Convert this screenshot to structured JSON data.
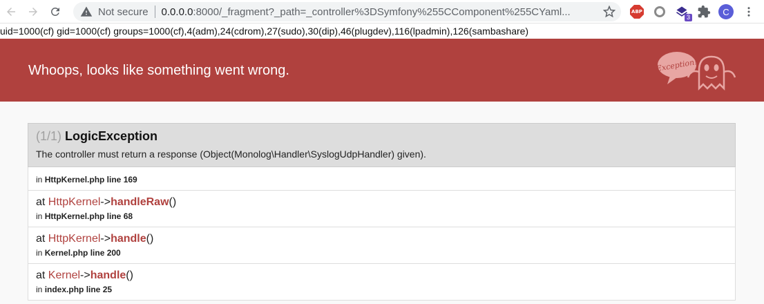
{
  "browser": {
    "not_secure": "Not secure",
    "url_host": "0.0.0.0",
    "url_rest": ":8000/_fragment?_path=_controller%3DSymfony%255CComponent%255CYaml...",
    "ext_abp": "ABP",
    "ext_badge": "3",
    "avatar_letter": "C",
    "icons": [
      "back-icon",
      "forward-icon",
      "reload-icon",
      "warning-icon",
      "star-icon",
      "adblock-icon",
      "extension-icon",
      "puzzle-icon",
      "menu-icon"
    ]
  },
  "output_line": "uid=1000(cf) gid=1000(cf) groups=1000(cf),4(adm),24(cdrom),27(sudo),30(dip),46(plugdev),116(lpadmin),126(sambashare)",
  "exception": {
    "header_title": "Whoops, looks like something went wrong.",
    "ghost_label": "Exception!",
    "count": "(1/1)",
    "class": "LogicException",
    "message": "The controller must return a response (Object(Monolog\\Handler\\SyslogUdpHandler) given).",
    "first_location": {
      "prefix": "in",
      "file": "HttpKernel.php line 169"
    },
    "trace": [
      {
        "at": "at",
        "cls": "HttpKernel",
        "arrow": "->",
        "method": "handleRaw",
        "args": "()",
        "in": "in",
        "file": "HttpKernel.php line 68"
      },
      {
        "at": "at",
        "cls": "HttpKernel",
        "arrow": "->",
        "method": "handle",
        "args": "()",
        "in": "in",
        "file": "Kernel.php line 200"
      },
      {
        "at": "at",
        "cls": "Kernel",
        "arrow": "->",
        "method": "handle",
        "args": "()",
        "in": "in",
        "file": "index.php line 25"
      }
    ]
  },
  "colors": {
    "accent": "#b0413e",
    "panel": "#dddddd"
  }
}
